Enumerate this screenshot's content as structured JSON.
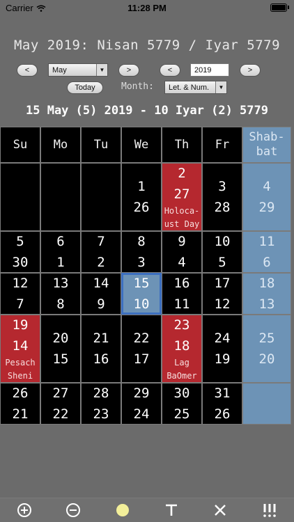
{
  "status": {
    "carrier": "Carrier",
    "time": "11:28 PM"
  },
  "title": "May 2019: Nisan 5779 / Iyar 5779",
  "controls": {
    "prev": "<",
    "next": ">",
    "month_value": "May",
    "year_prev": "<",
    "year_next": ">",
    "year_value": "2019",
    "today": "Today",
    "month_label": "Month:",
    "format_value": "Let. & Num."
  },
  "date_heading": "15 May (5) 2019 - 10 Iyar (2) 5779",
  "calendar": {
    "headers": [
      "Su",
      "Mo",
      "Tu",
      "We",
      "Th",
      "Fr",
      "Shab-\nbat"
    ],
    "weeks": [
      [
        {
          "g": "",
          "h": "",
          "t": "empty"
        },
        {
          "g": "",
          "h": "",
          "t": "empty"
        },
        {
          "g": "",
          "h": "",
          "t": "empty"
        },
        {
          "g": "1",
          "h": "26"
        },
        {
          "g": "2",
          "h": "27",
          "t": "red",
          "ev": "Holoca-\nust Day"
        },
        {
          "g": "3",
          "h": "28"
        },
        {
          "g": "4",
          "h": "29",
          "t": "sab"
        }
      ],
      [
        {
          "g": "5",
          "h": "30"
        },
        {
          "g": "6",
          "h": "1"
        },
        {
          "g": "7",
          "h": "2"
        },
        {
          "g": "8",
          "h": "3"
        },
        {
          "g": "9",
          "h": "4"
        },
        {
          "g": "10",
          "h": "5"
        },
        {
          "g": "11",
          "h": "6",
          "t": "sab"
        }
      ],
      [
        {
          "g": "12",
          "h": "7"
        },
        {
          "g": "13",
          "h": "8"
        },
        {
          "g": "14",
          "h": "9"
        },
        {
          "g": "15",
          "h": "10",
          "t": "sel"
        },
        {
          "g": "16",
          "h": "11"
        },
        {
          "g": "17",
          "h": "12"
        },
        {
          "g": "18",
          "h": "13",
          "t": "sab"
        }
      ],
      [
        {
          "g": "19",
          "h": "14",
          "t": "red",
          "ev": "Pesach\nSheni"
        },
        {
          "g": "20",
          "h": "15"
        },
        {
          "g": "21",
          "h": "16"
        },
        {
          "g": "22",
          "h": "17"
        },
        {
          "g": "23",
          "h": "18",
          "t": "red",
          "ev": "Lag\nBaOmer"
        },
        {
          "g": "24",
          "h": "19"
        },
        {
          "g": "25",
          "h": "20",
          "t": "sab"
        }
      ],
      [
        {
          "g": "26",
          "h": "21"
        },
        {
          "g": "27",
          "h": "22"
        },
        {
          "g": "28",
          "h": "23"
        },
        {
          "g": "29",
          "h": "24"
        },
        {
          "g": "30",
          "h": "25"
        },
        {
          "g": "31",
          "h": "26"
        },
        {
          "g": "",
          "h": "",
          "t": "sab"
        }
      ]
    ]
  },
  "toolbar": {
    "icons": [
      "zoom-in-icon",
      "zoom-out-icon",
      "sun-icon",
      "text-icon",
      "close-icon",
      "alert-icon"
    ]
  }
}
